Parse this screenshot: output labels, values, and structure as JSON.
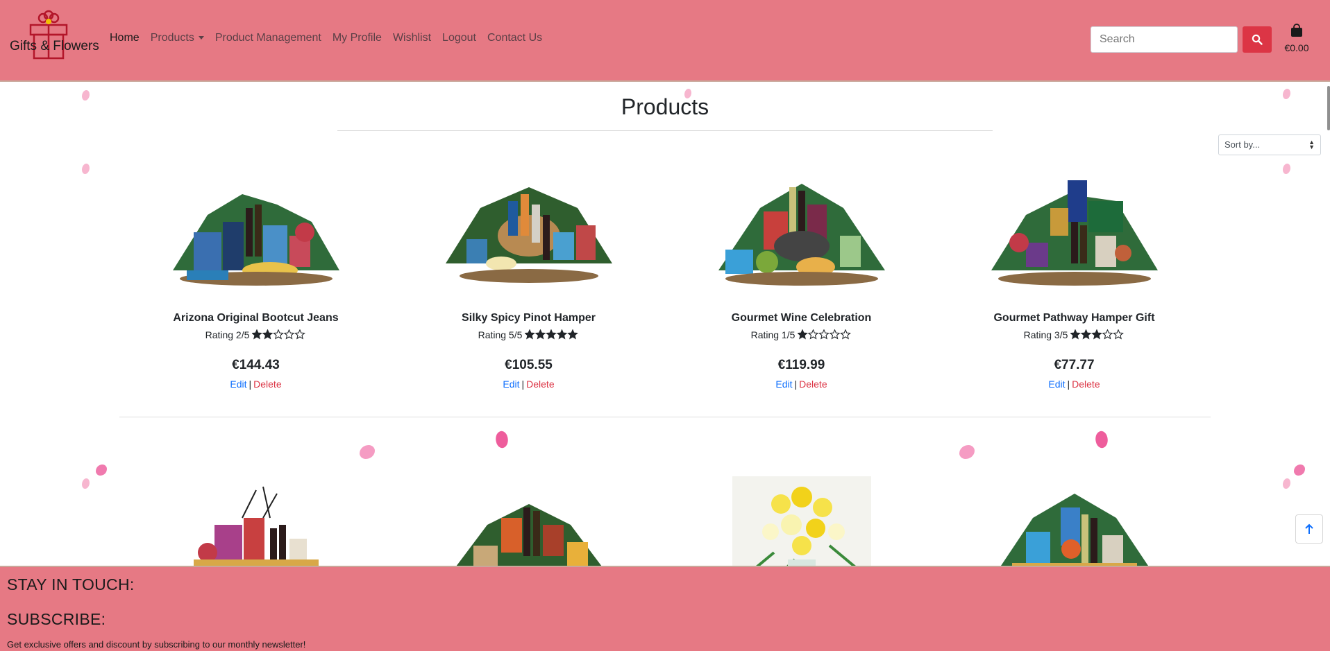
{
  "brand": {
    "name": "Gifts & Flowers"
  },
  "nav": {
    "home": "Home",
    "products": "Products",
    "product_management": "Product Management",
    "my_profile": "My Profile",
    "wishlist": "Wishlist",
    "logout": "Logout",
    "contact_us": "Contact Us"
  },
  "search": {
    "placeholder": "Search",
    "icon": "search-icon"
  },
  "cart": {
    "icon": "shopping-bag-icon",
    "total": "€0.00"
  },
  "page": {
    "title": "Products",
    "sort_placeholder": "Sort by..."
  },
  "products": [
    {
      "name": "Arizona Original Bootcut Jeans",
      "rating_text": "Rating 2/5",
      "rating": 2,
      "price": "€144.43",
      "edit": "Edit",
      "delete": "Delete"
    },
    {
      "name": "Silky Spicy Pinot Hamper",
      "rating_text": "Rating 5/5",
      "rating": 5,
      "price": "€105.55",
      "edit": "Edit",
      "delete": "Delete"
    },
    {
      "name": "Gourmet Wine Celebration",
      "rating_text": "Rating 1/5",
      "rating": 1,
      "price": "€119.99",
      "edit": "Edit",
      "delete": "Delete"
    },
    {
      "name": "Gourmet Pathway Hamper Gift",
      "rating_text": "Rating 3/5",
      "rating": 3,
      "price": "€77.77",
      "edit": "Edit",
      "delete": "Delete"
    }
  ],
  "footer": {
    "stay_in_touch": "STAY IN TOUCH:",
    "subscribe": "SUBSCRIBE:",
    "newsletter_text": "Get exclusive offers and discount by subscribing to our monthly newsletter!"
  },
  "colors": {
    "header_bg": "#e67984",
    "accent_red": "#dc3545",
    "link_blue": "#0d6efd"
  }
}
